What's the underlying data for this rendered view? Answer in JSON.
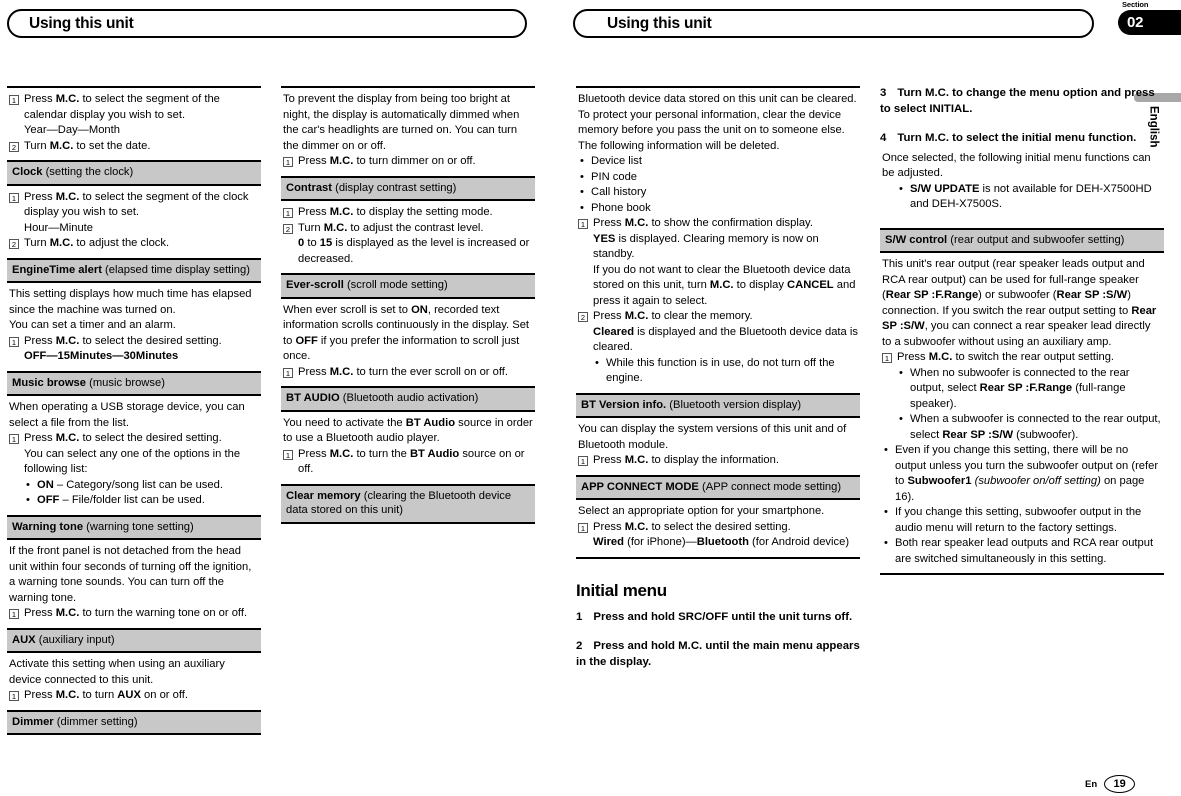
{
  "header": {
    "left_title": "Using this unit",
    "right_title": "Using this unit",
    "section_label": "Section",
    "section_number": "02",
    "language_tab": "English"
  },
  "footer": {
    "lang": "En",
    "page": "19"
  },
  "col1": {
    "calendar_step1_num": "1",
    "calendar_step1": "Press M.C. to select the segment of the calendar display you wish to set.",
    "calendar_order": "Year—Day—Month",
    "calendar_step2_num": "2",
    "calendar_step2": "Turn M.C. to set the date.",
    "clock_head_bold": "Clock",
    "clock_head_plain": " (setting the clock)",
    "clock_step1_num": "1",
    "clock_step1": "Press M.C. to select the segment of the clock display you wish to set.",
    "clock_order": "Hour—Minute",
    "clock_step2_num": "2",
    "clock_step2": "Turn M.C. to adjust the clock.",
    "engine_head_bold": "EngineTime alert",
    "engine_head_plain": " (elapsed time display setting)",
    "engine_p1": "This setting displays how much time has elapsed since the machine was turned on.",
    "engine_p2": "You can set a timer and an alarm.",
    "engine_step1_num": "1",
    "engine_step1": "Press M.C. to select the desired setting.",
    "engine_options": "OFF—15Minutes—30Minutes",
    "music_head_bold": "Music browse",
    "music_head_plain": " (music browse)",
    "music_p1": "When operating a USB storage device, you can select a file from the list.",
    "music_step1_num": "1",
    "music_step1": "Press M.C. to select the desired setting.",
    "music_step1_sub": "You can select any one of the options in the following list:",
    "music_bullet1_bold": "ON",
    "music_bullet1_rest": " – Category/song list can be used.",
    "music_bullet2_bold": "OFF",
    "music_bullet2_rest": " – File/folder list can be used.",
    "warn_head_bold": "Warning tone",
    "warn_head_plain": " (warning tone setting)",
    "warn_p1": "If the front panel is not detached from the head unit within four seconds of turning off the ignition, a warning tone sounds. You can turn off the warning tone.",
    "warn_step1_num": "1",
    "warn_step1": "Press M.C. to turn the warning tone on or off.",
    "aux_head_bold": "AUX",
    "aux_head_plain": " (auxiliary input)",
    "aux_p1": "Activate this setting when using an auxiliary device connected to this unit.",
    "aux_step1_num": "1",
    "aux_step1": "Press M.C. to turn AUX on or off.",
    "dimmer_head_bold": "Dimmer",
    "dimmer_head_plain": " (dimmer setting)"
  },
  "col2": {
    "dimmer_p1": "To prevent the display from being too bright at night, the display is automatically dimmed when the car's headlights are turned on. You can turn the dimmer on or off.",
    "dimmer_step1_num": "1",
    "dimmer_step1": "Press M.C. to turn dimmer on or off.",
    "contrast_head_bold": "Contrast",
    "contrast_head_plain": " (display contrast setting)",
    "contrast_step1_num": "1",
    "contrast_step1": "Press M.C. to display the setting mode.",
    "contrast_step2_num": "2",
    "contrast_step2": "Turn M.C. to adjust the contrast level.",
    "contrast_step2_sub": "0 to 15 is displayed as the level is increased or decreased.",
    "ever_head_bold": "Ever-scroll",
    "ever_head_plain": " (scroll mode setting)",
    "ever_p1": "When ever scroll is set to ON, recorded text information scrolls continuously in the display. Set to OFF if you prefer the information to scroll just once.",
    "ever_step1_num": "1",
    "ever_step1": "Press M.C. to turn the ever scroll on or off.",
    "btaudio_head_bold": "BT AUDIO",
    "btaudio_head_plain": " (Bluetooth audio activation)",
    "btaudio_p1": "You need to activate the BT Audio source in order to use a Bluetooth audio player.",
    "btaudio_step1_num": "1",
    "btaudio_step1": "Press M.C. to turn the BT Audio source on or off.",
    "clearmem_head_bold": "Clear memory",
    "clearmem_head_plain": " (clearing the Bluetooth device data stored on this unit)"
  },
  "col3": {
    "clear_p1": "Bluetooth device data stored on this unit can be cleared. To protect your personal information, clear the device memory before you pass the unit on to someone else. The following information will be deleted.",
    "clear_bullets": [
      "Device list",
      "PIN code",
      "Call history",
      "Phone book"
    ],
    "clear_step1_num": "1",
    "clear_step1": "Press M.C. to show the confirmation display.",
    "clear_step1_sub1": "YES is displayed. Clearing memory is now on standby.",
    "clear_step1_sub2": "If you do not want to clear the Bluetooth device data stored on this unit, turn M.C. to display CANCEL and press it again to select.",
    "clear_step2_num": "2",
    "clear_step2": "Press M.C. to clear the memory.",
    "clear_step2_sub": "Cleared is displayed and the Bluetooth device data is cleared.",
    "clear_step2_bullet": "While this function is in use, do not turn off the engine.",
    "btver_head_bold": "BT Version info.",
    "btver_head_plain": " (Bluetooth version display)",
    "btver_p1": "You can display the system versions of this unit and of Bluetooth module.",
    "btver_step1_num": "1",
    "btver_step1": "Press M.C. to display the information.",
    "app_head_bold": "APP CONNECT MODE",
    "app_head_plain": " (APP connect mode setting)",
    "app_p1": "Select an appropriate option for your smartphone.",
    "app_step1_num": "1",
    "app_step1": "Press M.C. to select the desired setting.",
    "app_step1_sub": "Wired (for iPhone)—Bluetooth (for Android device)",
    "initial_menu_title": "Initial menu",
    "step1_num": "1",
    "step1_text": "Press and hold SRC/OFF until the unit turns off.",
    "step2_num": "2",
    "step2_text": "Press and hold M.C. until the main menu appears in the display."
  },
  "col4": {
    "step3_num": "3",
    "step3_text": "Turn M.C. to change the menu option and press to select INITIAL.",
    "step4_num": "4",
    "step4_text": "Turn M.C. to select the initial menu function.",
    "step4_p": "Once selected, the following initial menu functions can be adjusted.",
    "step4_bullet_bold": "S/W UPDATE",
    "step4_bullet_rest": " is not available for DEH-X7500HD and DEH-X7500S.",
    "sw_head_bold": "S/W control",
    "sw_head_plain": " (rear output and subwoofer setting)",
    "sw_p1": "This unit's rear output (rear speaker leads output and RCA rear output) can be used for full-range speaker (Rear SP :F.Range) or subwoofer (Rear SP :S/W) connection. If you switch the rear output setting to Rear SP :S/W, you can connect a rear speaker lead directly to a subwoofer without using an auxiliary amp.",
    "sw_step1_num": "1",
    "sw_step1": "Press M.C. to switch the rear output setting.",
    "sw_sub_bullet1": "When no subwoofer is connected to the rear output, select Rear SP :F.Range (full-range speaker).",
    "sw_sub_bullet2": "When a subwoofer is connected to the rear output, select Rear SP :S/W (subwoofer).",
    "sw_bullet1": "Even if you change this setting, there will be no output unless you turn the subwoofer output on (refer to Subwoofer1 (subwoofer on/off setting) on page 16).",
    "sw_bullet2": "If you change this setting, subwoofer output in the audio menu will return to the factory settings.",
    "sw_bullet3": "Both rear speaker lead outputs and RCA rear output are switched simultaneously in this setting.",
    "bullet_glyph": "•"
  }
}
